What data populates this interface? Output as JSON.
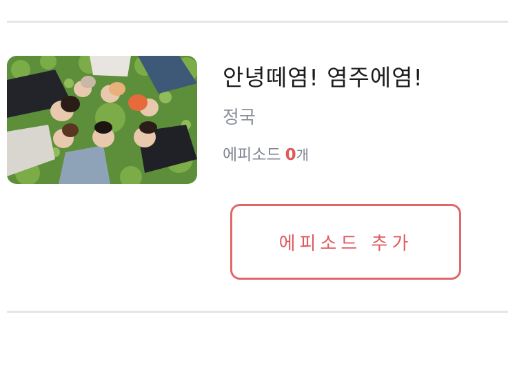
{
  "story": {
    "title": "안녕떼염! 염주에염!",
    "author": "정국",
    "episodes_label": "에피소드",
    "episodes_count": "0",
    "episodes_unit": "개",
    "cover_image": "group-photo-lying-in-grass"
  },
  "actions": {
    "add_episode_label": "에피소드 추가"
  },
  "colors": {
    "accent": "#e0666a",
    "divider": "#e6e6e6",
    "muted_text": "#8a8f99"
  }
}
